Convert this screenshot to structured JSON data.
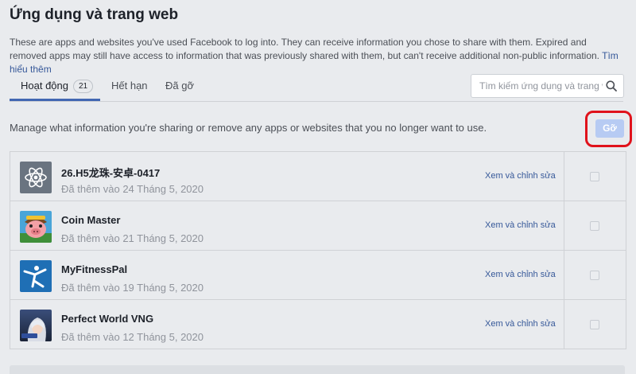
{
  "page": {
    "title": "Ứng dụng và trang web",
    "description": "These are apps and websites you've used Facebook to log into. They can receive information you chose to share with them. Expired and removed apps may still have access to information that was previously shared with them, but can't receive additional non-public information.",
    "learn_more": "Tìm hiểu thêm",
    "manage_text": "Manage what information you're sharing or remove any apps or websites that you no longer want to use."
  },
  "tabs": [
    {
      "label": "Hoạt động",
      "badge": "21"
    },
    {
      "label": "Hết hạn"
    },
    {
      "label": "Đã gỡ"
    }
  ],
  "search": {
    "placeholder": "Tìm kiếm ứng dụng và trang web",
    "icon": "search-icon"
  },
  "remove_button": {
    "label": "Gỡ"
  },
  "apps": [
    {
      "name": "26.H5龙珠-安卓-0417",
      "date": "Đã thêm vào 24 Tháng 5, 2020",
      "edit": "Xem và chỉnh sửa",
      "icon": "atom-icon"
    },
    {
      "name": "Coin Master",
      "date": "Đã thêm vào 21 Tháng 5, 2020",
      "edit": "Xem và chỉnh sửa",
      "icon": "coin-master-icon"
    },
    {
      "name": "MyFitnessPal",
      "date": "Đã thêm vào 19 Tháng 5, 2020",
      "edit": "Xem và chỉnh sửa",
      "icon": "myfitnesspal-icon"
    },
    {
      "name": "Perfect World VNG",
      "date": "Đã thêm vào 12 Tháng 5, 2020",
      "edit": "Xem và chỉnh sửa",
      "icon": "perfect-world-icon"
    }
  ],
  "colors": {
    "background": "#e9ebee",
    "link": "#365899",
    "tab_active_underline": "#4267b2",
    "remove_button_bg": "#b7cbf3",
    "highlight_ring": "#e0121b"
  }
}
